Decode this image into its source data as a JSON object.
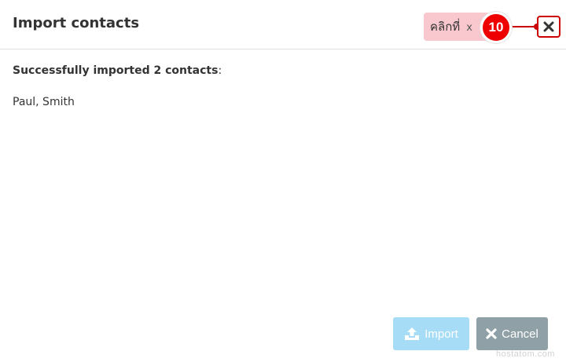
{
  "dialog": {
    "title": "Import contacts",
    "close_icon": "close-icon"
  },
  "tutorial": {
    "tip_text": "คลิกที่",
    "tip_close": "x",
    "step_number": "10"
  },
  "body": {
    "success_bold": "Successfully imported 2 contacts",
    "success_suffix": ":",
    "contacts": "Paul, Smith"
  },
  "footer": {
    "import_label": "Import",
    "import_icon": "upload-icon",
    "cancel_label": "Cancel",
    "cancel_icon": "times-icon"
  },
  "watermark": "hostatom.com",
  "colors": {
    "import_button": "#a6dcf6",
    "cancel_button": "#8fa1a6",
    "tip_background": "#f9c8cf",
    "step_badge": "#ee0000",
    "highlight": "#cc0000"
  }
}
